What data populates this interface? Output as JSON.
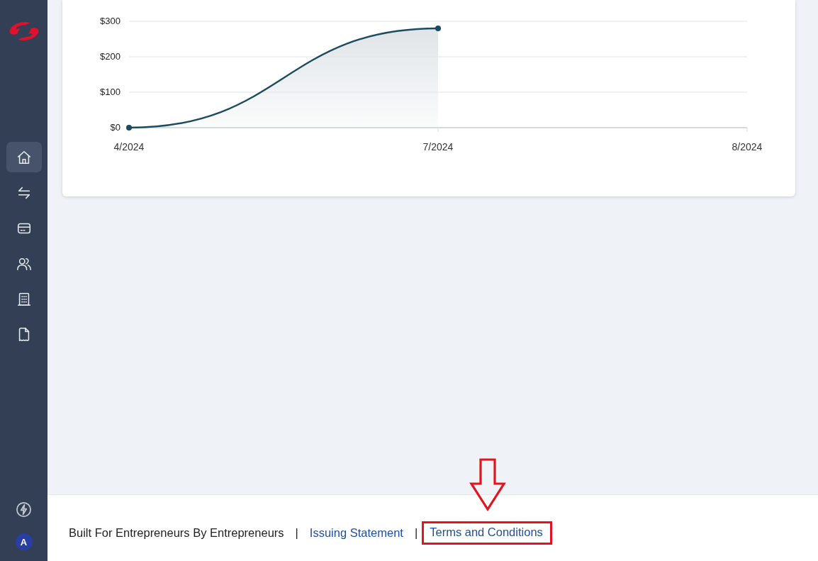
{
  "sidebar": {
    "items": [
      {
        "kind": "home",
        "selected": true
      },
      {
        "kind": "transfer",
        "selected": false
      },
      {
        "kind": "card",
        "selected": false
      },
      {
        "kind": "users",
        "selected": false
      },
      {
        "kind": "building",
        "selected": false
      },
      {
        "kind": "receipt",
        "selected": false
      }
    ],
    "avatar": "A"
  },
  "chart": {
    "chart_data": {
      "type": "area",
      "categories": [
        "4/2024",
        "7/2024",
        "8/2024"
      ],
      "series": [
        {
          "color": "#1b4b5e",
          "values": [
            0,
            280,
            null
          ]
        }
      ],
      "grid": true,
      "ylim": [
        0,
        300
      ],
      "yticks": [
        {
          "value": 0,
          "label": "$0"
        },
        {
          "value": 100,
          "label": "$100"
        },
        {
          "value": 200,
          "label": "$200"
        },
        {
          "value": 300,
          "label": "$300"
        }
      ]
    }
  },
  "footer": {
    "items": [
      {
        "kind": "text",
        "label": "Built For Entrepreneurs By Entrepreneurs"
      },
      {
        "kind": "separator",
        "label": "|"
      },
      {
        "kind": "link",
        "label": "Issuing Statement",
        "highlighted": false
      },
      {
        "kind": "separator",
        "label": "|"
      },
      {
        "kind": "link",
        "label": "Terms and Conditions",
        "highlighted": true
      }
    ]
  }
}
